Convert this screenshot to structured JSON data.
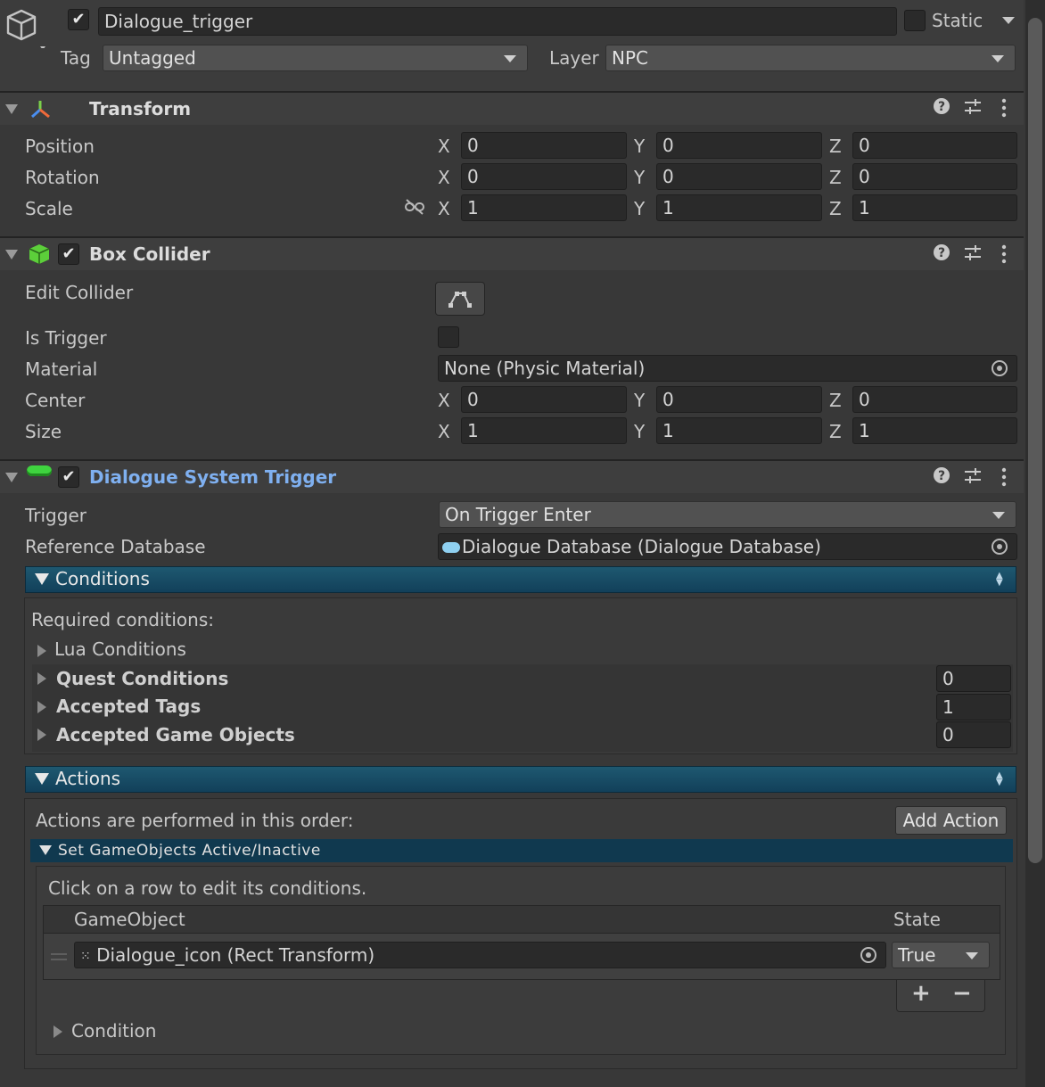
{
  "gameobject": {
    "name": "Dialogue_trigger",
    "active": true,
    "static_label": "Static",
    "tag_label": "Tag",
    "tag_value": "Untagged",
    "layer_label": "Layer",
    "layer_value": "NPC"
  },
  "transform": {
    "title": "Transform",
    "rows": [
      {
        "label": "Position",
        "x": "0",
        "y": "0",
        "z": "0"
      },
      {
        "label": "Rotation",
        "x": "0",
        "y": "0",
        "z": "0"
      },
      {
        "label": "Scale",
        "x": "1",
        "y": "1",
        "z": "1"
      }
    ]
  },
  "axes": {
    "x": "X",
    "y": "Y",
    "z": "Z"
  },
  "box_collider": {
    "title": "Box Collider",
    "enabled": true,
    "edit_collider_label": "Edit Collider",
    "is_trigger_label": "Is Trigger",
    "is_trigger": false,
    "material_label": "Material",
    "material_value": "None (Physic Material)",
    "center_label": "Center",
    "center": {
      "x": "0",
      "y": "0",
      "z": "0"
    },
    "size_label": "Size",
    "size": {
      "x": "1",
      "y": "1",
      "z": "1"
    }
  },
  "dialogue_trigger": {
    "title": "Dialogue System Trigger",
    "enabled": true,
    "trigger_label": "Trigger",
    "trigger_value": "On Trigger Enter",
    "reference_db_label": "Reference Database",
    "reference_db_value": "Dialogue Database (Dialogue Database)",
    "conditions": {
      "title": "Conditions",
      "required_label": "Required conditions:",
      "lua_label": "Lua Conditions",
      "items": [
        {
          "label": "Quest Conditions",
          "count": "0"
        },
        {
          "label": "Accepted Tags",
          "count": "1"
        },
        {
          "label": "Accepted Game Objects",
          "count": "0"
        }
      ]
    },
    "actions": {
      "title": "Actions",
      "order_label": "Actions are performed in this order:",
      "add_action_label": "Add Action",
      "set_active_title": "Set GameObjects Active/Inactive",
      "hint": "Click on a row to edit its conditions.",
      "col_gameobject": "GameObject",
      "col_state": "State",
      "row_object": "Dialogue_icon (Rect Transform)",
      "row_state": "True",
      "plus_label": "+",
      "minus_label": "−",
      "condition_label": "Condition"
    }
  },
  "colors": {
    "background": "#383838",
    "field": "#2a2a2a",
    "blue_bar": "#1b4f68",
    "link_title": "#7fb0f0",
    "component_green": "#4dc94d"
  }
}
